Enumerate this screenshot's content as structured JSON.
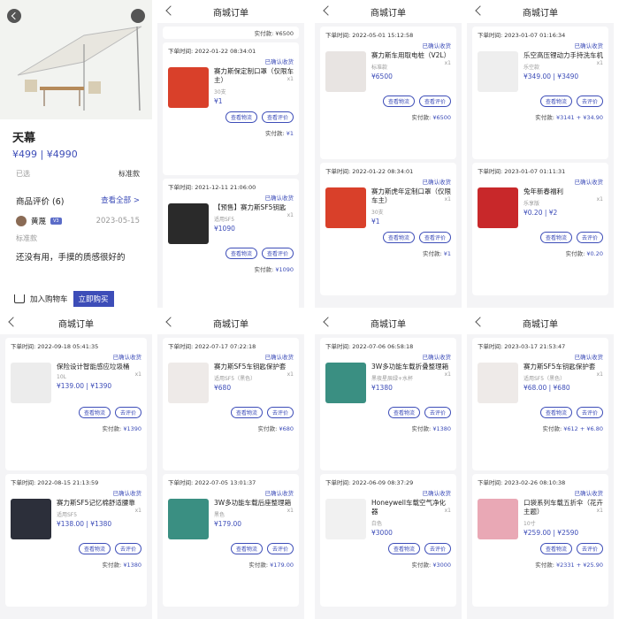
{
  "product": {
    "title": "天幕",
    "price": "¥499 | ¥4990",
    "selected_label": "已选",
    "selected_value": "标准款",
    "review_heading": "商品评价",
    "review_count": "(6)",
    "view_all": "查看全部 >",
    "reviewer": "黄蔑",
    "reviewer_badge": "V3",
    "review_date": "2023-05-15",
    "review_spec": "标准款",
    "review_text": "还没有用，手摸的质感很好的",
    "add_cart": "加入购物车",
    "buy_now": "立即购买"
  },
  "nav_title": "商城订单",
  "buttons": {
    "logistics": "查看物流",
    "review": "查看评价",
    "review_alt": "去评价"
  },
  "paid_label": "实付款:",
  "panels": [
    {
      "orders": [
        {
          "time": "下单时间: 2022-01-22 08:34:01",
          "status": "已确认收货",
          "name": "赛力斯保定制口罩（仅限车主）",
          "spec": "30支",
          "price": "¥1",
          "qty": "x1",
          "paid": "¥1",
          "b2": "查看评价",
          "thumb": "#d9402a"
        },
        {
          "time": "下单时间: 2021-12-11 21:06:00",
          "status": "已确认收货",
          "name": "【预售】赛力斯SF5钥匙",
          "spec": "适用SF5",
          "price": "¥1090",
          "qty": "x1",
          "paid": "¥1090",
          "b2": "查看评价",
          "thumb": "#2a2a2a"
        }
      ],
      "top_paid": "实付款: ¥6500"
    },
    {
      "orders": [
        {
          "time": "下单时间: 2022-05-01 15:12:58",
          "status": "已确认收货",
          "name": "赛力斯车用取电桩（V2L）",
          "spec": "标准款",
          "price": "¥6500",
          "qty": "x1",
          "paid": "¥6500",
          "b2": "查看评价",
          "thumb": "#e8e4e2"
        },
        {
          "time": "下单时间: 2022-01-22 08:34:01",
          "status": "已确认收货",
          "name": "赛力斯虎年定制口罩（仅限车主）",
          "spec": "30支",
          "price": "¥1",
          "qty": "x1",
          "paid": "¥1",
          "b2": "查看评价",
          "thumb": "#d9402a"
        }
      ]
    },
    {
      "orders": [
        {
          "time": "下单时间: 2023-01-07 01:16:34",
          "status": "已确认收货",
          "name": "乐空高压锂动力手持洗车机",
          "spec": "乐空款",
          "price": "¥349.00 | ¥3490",
          "qty": "x1",
          "paid": "¥3141 + ¥34.90",
          "b2": "去评价",
          "thumb": "#eeeeee"
        },
        {
          "time": "下单时间: 2023-01-07 01:11:31",
          "status": "已确认收货",
          "name": "兔年新春福利",
          "spec": "乐享版",
          "price": "¥0.20 | ¥2",
          "qty": "x1",
          "paid": "¥0.20",
          "b2": "去评价",
          "thumb": "#c8282a"
        }
      ]
    },
    {
      "orders": [
        {
          "time": "下单时间: 2022-09-18 05:41:35",
          "status": "已确认收货",
          "name": "保险设计智能感应垃圾桶",
          "spec": "10L",
          "price": "¥139.00 | ¥1390",
          "qty": "x1",
          "paid": "¥1390",
          "b2": "去评价",
          "thumb": "#ececec"
        },
        {
          "time": "下单时间: 2022-08-15 21:13:59",
          "status": "已确认收货",
          "name": "赛力斯SF5记忆棉舒适腰靠",
          "spec": "适用SF5",
          "price": "¥138.00 | ¥1380",
          "qty": "x1",
          "paid": "¥1380",
          "b2": "去评价",
          "thumb": "#2c2f3a"
        }
      ]
    },
    {
      "orders": [
        {
          "time": "下单时间: 2022-07-17 07:22:18",
          "status": "已确认收货",
          "name": "赛力斯SF5车钥匙保护套",
          "spec": "适用SF5（黑色）",
          "price": "¥680",
          "qty": "x1",
          "paid": "¥680",
          "b2": "去评价",
          "thumb": "#eeeae8"
        },
        {
          "time": "下单时间: 2022-07-05 13:01:37",
          "status": "已确认收货",
          "name": "3W多功能车载后座整理箱",
          "spec": "黑色",
          "price": "¥179.00",
          "qty": "x1",
          "paid": "¥179.00",
          "b2": "去评价",
          "thumb": "#3a8f82"
        }
      ]
    },
    {
      "orders": [
        {
          "time": "下单时间: 2022-07-06 06:58:18",
          "status": "已确认收货",
          "name": "3W多功能车载折叠整理箱",
          "spec": "黑夜星辰绿+水杯",
          "price": "¥1380",
          "qty": "x1",
          "paid": "¥1380",
          "b2": "去评价",
          "thumb": "#3a8f82"
        },
        {
          "time": "下单时间: 2022-06-09 08:37:29",
          "status": "已确认收货",
          "name": "Honeywell车载空气净化器",
          "spec": "白色",
          "price": "¥3000",
          "qty": "x1",
          "paid": "¥3000",
          "b2": "去评价",
          "thumb": "#f1f1f1"
        }
      ]
    },
    {
      "orders": [
        {
          "time": "下单时间: 2023-03-17 21:53:47",
          "status": "已确认收货",
          "name": "赛力斯SF5车钥匙保护套",
          "spec": "适用SF5（黑色）",
          "price": "¥68.00 | ¥680",
          "qty": "x1",
          "paid": "¥612 + ¥6.80",
          "b2": "去评价",
          "thumb": "#eeeae8"
        },
        {
          "time": "下单时间: 2023-02-26 08:10:38",
          "status": "已确认收货",
          "name": "口袋系列车载五折伞（花卉主题）",
          "spec": "10寸",
          "price": "¥259.00 | ¥2590",
          "qty": "x1",
          "paid": "¥2331 + ¥25.90",
          "b2": "去评价",
          "thumb": "#e9a8b5"
        }
      ]
    }
  ]
}
